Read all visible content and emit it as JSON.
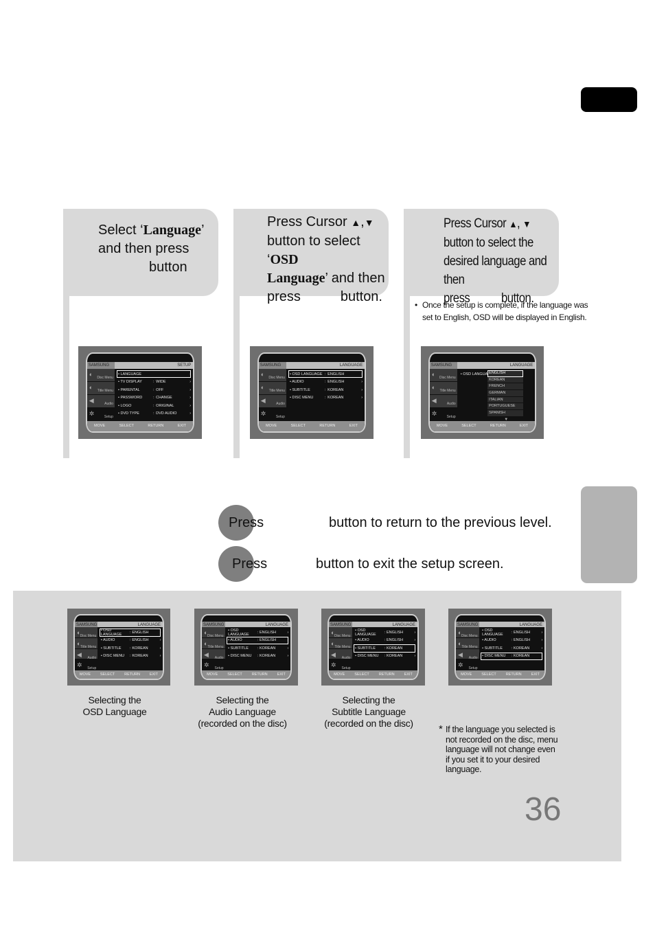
{
  "steps": [
    {
      "line1_prefix": "Select ‘",
      "line1_bold": "Language",
      "line1_suffix": "’",
      "line2": "and then press",
      "line3": "button"
    },
    {
      "line1": "Press Cursor",
      "up_icon": "▲",
      "comma": ",",
      "down_icon": "▼",
      "line2_prefix": "button to select ‘",
      "line2_bold": "OSD",
      "line3_bold": "Language",
      "line3_suffix": "’ and then",
      "line4_left": "press",
      "line4_right": "button."
    },
    {
      "line1": "Press Cursor",
      "up_icon": "▲",
      "comma": ",",
      "down_icon": "▼",
      "line2": "button to select the",
      "line3": "desired language and then",
      "line4_left": "press",
      "line4_right": "button.",
      "note_bullet": "•",
      "note_line1": "Once the setup is complete, if the language was",
      "note_line2": "set to English, OSD will be displayed in English."
    }
  ],
  "osd": {
    "logo": "SAMSUNG",
    "sidebar": [
      "Disc Menu",
      "Title Menu",
      "Audio",
      "Setup"
    ],
    "footer": [
      "MOVE",
      "SELECT",
      "RETURN",
      "EXIT"
    ],
    "setup_screen": {
      "title": "SETUP",
      "rows": [
        {
          "key": "LANGUAGE",
          "colon": "",
          "value": ""
        },
        {
          "key": "TV DISPLAY",
          "colon": ":",
          "value": "WIDE"
        },
        {
          "key": "PARENTAL",
          "colon": ":",
          "value": "OFF"
        },
        {
          "key": "PASSWORD",
          "colon": ":",
          "value": "CHANGE"
        },
        {
          "key": "LOGO",
          "colon": ":",
          "value": "ORIGINAL"
        },
        {
          "key": "DVD TYPE",
          "colon": ":",
          "value": "DVD AUDIO"
        }
      ],
      "selected_index": 0
    },
    "language_screen": {
      "title": "LANGUAGE",
      "rows": [
        {
          "key": "OSD LANGUAGE",
          "colon": ":",
          "value": "ENGLISH"
        },
        {
          "key": "AUDIO",
          "colon": ":",
          "value": "ENGLISH"
        },
        {
          "key": "SUBTITLE",
          "colon": ":",
          "value": "KOREAN"
        },
        {
          "key": "DISC MENU",
          "colon": ":",
          "value": "KOREAN"
        }
      ]
    },
    "osd_dropdown": {
      "title": "LANGUAGE",
      "label": "OSD LANGUAGE",
      "options": [
        "ENGLISH",
        "KOREAN",
        "FRENCH",
        "GERMAN",
        "ITALIAN",
        "PORTUGUESE",
        "SPANISH"
      ],
      "selected": "ENGLISH",
      "more_icon": "▼"
    },
    "arrow": "›"
  },
  "press_lines": [
    {
      "press": "Press",
      "text": "button to return to the previous level."
    },
    {
      "press": "Press",
      "text": "button to exit the setup screen."
    }
  ],
  "bottom": {
    "captions": [
      {
        "l1": "Selecting the",
        "l2": "OSD Language",
        "l3": ""
      },
      {
        "l1": "Selecting the",
        "l2": "Audio Language",
        "l3": "(recorded on the disc)"
      },
      {
        "l1": "Selecting the",
        "l2": "Subtitle Language",
        "l3": "(recorded on the disc)"
      }
    ],
    "footnote_star": "*",
    "footnote_lines": [
      "If the language you selected is",
      "not recorded on the disc, menu",
      "language will not change even",
      "if you set it to your desired",
      "language."
    ],
    "page_number": "36"
  }
}
